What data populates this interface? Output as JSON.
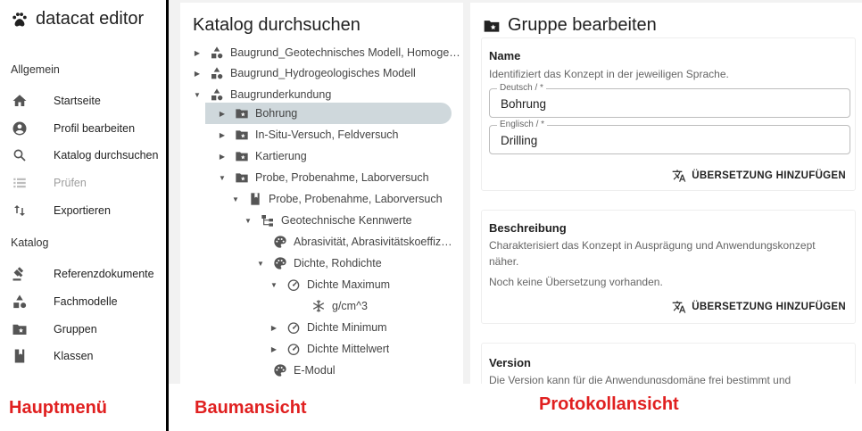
{
  "sidebar": {
    "brand": "datacat editor",
    "sections": [
      {
        "title": "Allgemein",
        "items": [
          {
            "label": "Startseite",
            "icon": "home-icon",
            "disabled": false
          },
          {
            "label": "Profil bearbeiten",
            "icon": "account-icon",
            "disabled": false
          },
          {
            "label": "Katalog durchsuchen",
            "icon": "search-icon",
            "disabled": false
          },
          {
            "label": "Prüfen",
            "icon": "list-icon",
            "disabled": true
          },
          {
            "label": "Exportieren",
            "icon": "swap-icon",
            "disabled": false
          }
        ]
      },
      {
        "title": "Katalog",
        "items": [
          {
            "label": "Referenzdokumente",
            "icon": "gavel-icon",
            "disabled": false
          },
          {
            "label": "Fachmodelle",
            "icon": "shapes-icon",
            "disabled": false
          },
          {
            "label": "Gruppen",
            "icon": "folder-star-icon",
            "disabled": false
          },
          {
            "label": "Klassen",
            "icon": "book-icon",
            "disabled": false
          }
        ]
      }
    ]
  },
  "tree": {
    "title": "Katalog durchsuchen",
    "nodes": [
      {
        "label": "Baugrund_Geotechnisches Modell, Homoge…",
        "icon": "shapes-icon",
        "arrow": "right",
        "selected": false
      },
      {
        "label": "Baugrund_Hydrogeologisches Modell",
        "icon": "shapes-icon",
        "arrow": "right",
        "selected": false
      },
      {
        "label": "Baugrunderkundung",
        "icon": "shapes-icon",
        "arrow": "down",
        "selected": false
      },
      {
        "label": "Bohrung",
        "icon": "folder-star-icon",
        "arrow": "right",
        "selected": true
      },
      {
        "label": "In-Situ-Versuch, Feldversuch",
        "icon": "folder-star-icon",
        "arrow": "right",
        "selected": false
      },
      {
        "label": "Kartierung",
        "icon": "folder-star-icon",
        "arrow": "right",
        "selected": false
      },
      {
        "label": "Probe, Probenahme, Laborversuch",
        "icon": "folder-star-icon",
        "arrow": "down",
        "selected": false
      },
      {
        "label": "Probe, Probenahme, Laborversuch",
        "icon": "book-icon",
        "arrow": "down",
        "selected": false
      },
      {
        "label": "Geotechnische Kennwerte",
        "icon": "hierarchy-icon",
        "arrow": "down",
        "selected": false
      },
      {
        "label": "Abrasivität, Abrasivitätskoeffiz…",
        "icon": "palette-icon",
        "arrow": "none",
        "selected": false
      },
      {
        "label": "Dichte, Rohdichte",
        "icon": "palette-icon",
        "arrow": "down",
        "selected": false
      },
      {
        "label": "Dichte Maximum",
        "icon": "gauge-icon",
        "arrow": "down",
        "selected": false
      },
      {
        "label": "g/cm^3",
        "icon": "snowflake-icon",
        "arrow": "none",
        "selected": false
      },
      {
        "label": "Dichte Minimum",
        "icon": "gauge-icon",
        "arrow": "right",
        "selected": false
      },
      {
        "label": "Dichte Mittelwert",
        "icon": "gauge-icon",
        "arrow": "right",
        "selected": false
      },
      {
        "label": "E-Modul",
        "icon": "palette-icon",
        "arrow": "none",
        "selected": false
      }
    ]
  },
  "editor": {
    "title": "Gruppe bearbeiten",
    "name_card": {
      "title": "Name",
      "description": "Identifiziert das Konzept in der jeweiligen Sprache.",
      "fields": [
        {
          "label": "Deutsch / *",
          "value": "Bohrung"
        },
        {
          "label": "Englisch / *",
          "value": "Drilling"
        }
      ],
      "button": "ÜBERSETZUNG HINZUFÜGEN"
    },
    "desc_card": {
      "title": "Beschreibung",
      "description": "Charakterisiert das Konzept in Ausprägung und Anwendungskonzept näher.",
      "empty": "Noch keine Übersetzung vorhanden.",
      "button": "ÜBERSETZUNG HINZUFÜGEN"
    },
    "version_card": {
      "title": "Version",
      "description": "Die Version kann für die Anwendungsdomäne frei bestimmt und"
    }
  },
  "captions": {
    "left": "Hauptmenü",
    "middle": "Baumansicht",
    "right": "Protokollansicht"
  },
  "colors": {
    "caption": "#e02020",
    "selected_row": "#cfd8dc",
    "panel_bg": "#f2f2f2"
  }
}
